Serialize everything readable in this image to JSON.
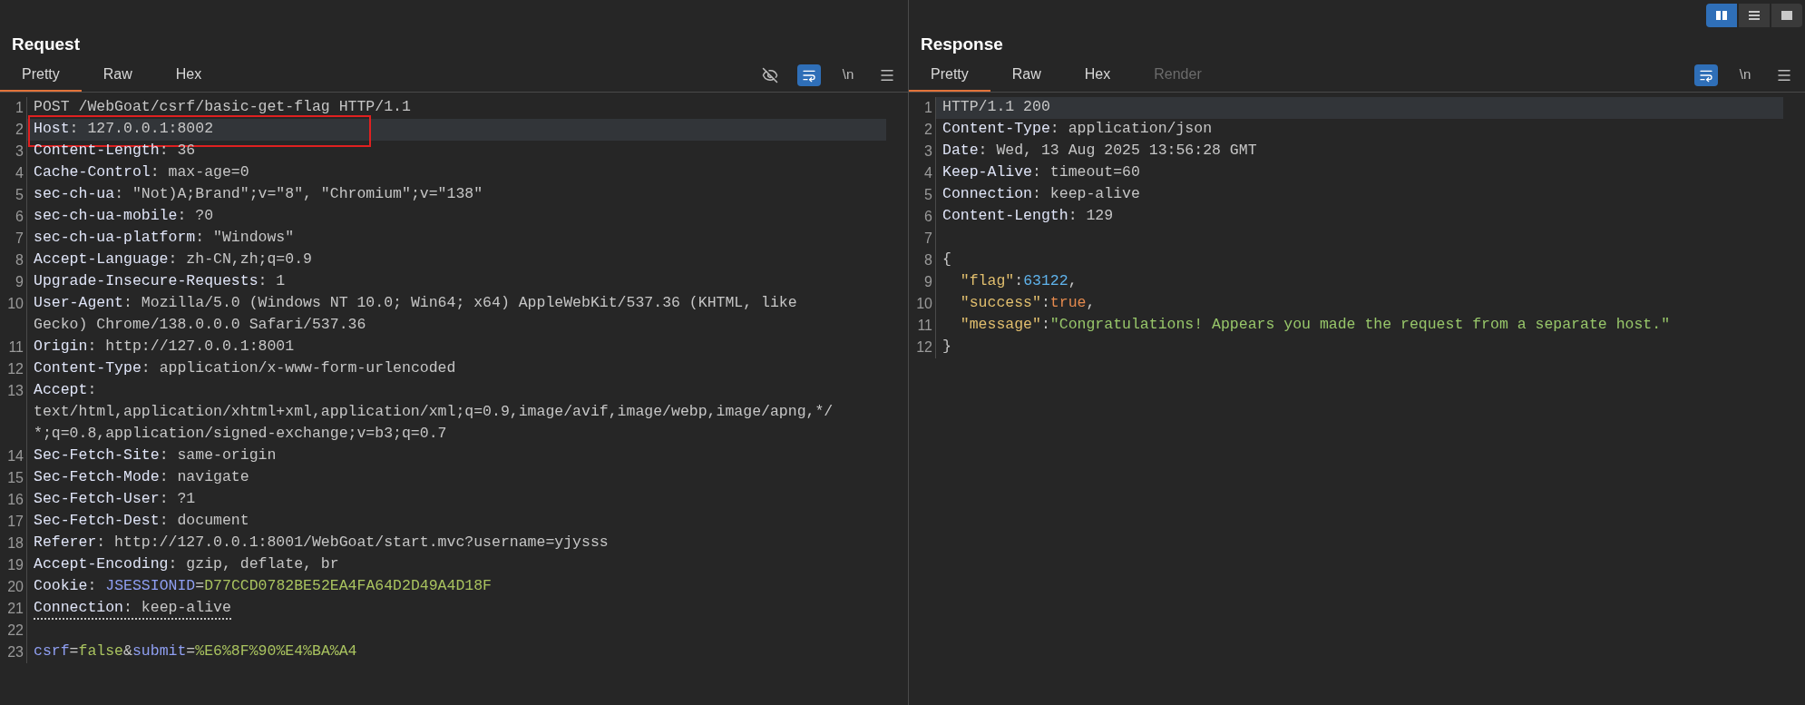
{
  "layout_toggles": [
    {
      "kind": "columns",
      "selected": true
    },
    {
      "kind": "rows",
      "selected": false
    },
    {
      "kind": "single",
      "selected": false
    }
  ],
  "panes": [
    {
      "title": "Request",
      "tabs": [
        {
          "label": "Pretty",
          "selected": true,
          "disabled": false
        },
        {
          "label": "Raw",
          "selected": false,
          "disabled": false
        },
        {
          "label": "Hex",
          "selected": false,
          "disabled": false
        }
      ],
      "toolbar": [
        {
          "kind": "eye-off",
          "on": false
        },
        {
          "kind": "wrap",
          "on": true
        },
        {
          "kind": "newline",
          "label": "\\n",
          "on": false
        },
        {
          "kind": "menu",
          "on": false
        }
      ],
      "lines": [
        {
          "number": "1",
          "selected": false,
          "boxed": false,
          "warning": false,
          "rows": [
            [
              {
                "kind": "text",
                "text": "POST /WebGoat/csrf/basic-get-flag HTTP/1.1"
              }
            ]
          ]
        },
        {
          "number": "2",
          "selected": true,
          "boxed": true,
          "warning": false,
          "rows": [
            [
              {
                "kind": "name",
                "text": "Host"
              },
              {
                "kind": "text",
                "text": ": 127.0.0.1:8002"
              }
            ]
          ]
        },
        {
          "number": "3",
          "selected": false,
          "boxed": false,
          "warning": false,
          "rows": [
            [
              {
                "kind": "name",
                "text": "Content-Length"
              },
              {
                "kind": "text",
                "text": ": 36"
              }
            ]
          ]
        },
        {
          "number": "4",
          "selected": false,
          "boxed": false,
          "warning": false,
          "rows": [
            [
              {
                "kind": "name",
                "text": "Cache-Control"
              },
              {
                "kind": "text",
                "text": ": max-age=0"
              }
            ]
          ]
        },
        {
          "number": "5",
          "selected": false,
          "boxed": false,
          "warning": false,
          "rows": [
            [
              {
                "kind": "name",
                "text": "sec-ch-ua"
              },
              {
                "kind": "text",
                "text": ": \"Not)A;Brand\";v=\"8\", \"Chromium\";v=\"138\""
              }
            ]
          ]
        },
        {
          "number": "6",
          "selected": false,
          "boxed": false,
          "warning": false,
          "rows": [
            [
              {
                "kind": "name",
                "text": "sec-ch-ua-mobile"
              },
              {
                "kind": "text",
                "text": ": ?0"
              }
            ]
          ]
        },
        {
          "number": "7",
          "selected": false,
          "boxed": false,
          "warning": false,
          "rows": [
            [
              {
                "kind": "name",
                "text": "sec-ch-ua-platform"
              },
              {
                "kind": "text",
                "text": ": \"Windows\""
              }
            ]
          ]
        },
        {
          "number": "8",
          "selected": false,
          "boxed": false,
          "warning": false,
          "rows": [
            [
              {
                "kind": "name",
                "text": "Accept-Language"
              },
              {
                "kind": "text",
                "text": ": zh-CN,zh;q=0.9"
              }
            ]
          ]
        },
        {
          "number": "9",
          "selected": false,
          "boxed": false,
          "warning": false,
          "rows": [
            [
              {
                "kind": "name",
                "text": "Upgrade-Insecure-Requests"
              },
              {
                "kind": "text",
                "text": ": 1"
              }
            ]
          ]
        },
        {
          "number": "10",
          "selected": false,
          "boxed": false,
          "warning": false,
          "rows": [
            [
              {
                "kind": "name",
                "text": "User-Agent"
              },
              {
                "kind": "text",
                "text": ": Mozilla/5.0 (Windows NT 10.0; Win64; x64) AppleWebKit/537.36 (KHTML, like"
              }
            ],
            [
              {
                "kind": "text",
                "text": "Gecko) Chrome/138.0.0.0 Safari/537.36"
              }
            ]
          ]
        },
        {
          "number": "11",
          "selected": false,
          "boxed": false,
          "warning": false,
          "rows": [
            [
              {
                "kind": "name",
                "text": "Origin"
              },
              {
                "kind": "text",
                "text": ": http://127.0.0.1:8001"
              }
            ]
          ]
        },
        {
          "number": "12",
          "selected": false,
          "boxed": false,
          "warning": false,
          "rows": [
            [
              {
                "kind": "name",
                "text": "Content-Type"
              },
              {
                "kind": "text",
                "text": ": application/x-www-form-urlencoded"
              }
            ]
          ]
        },
        {
          "number": "13",
          "selected": false,
          "boxed": false,
          "warning": false,
          "rows": [
            [
              {
                "kind": "name",
                "text": "Accept"
              },
              {
                "kind": "text",
                "text": ":"
              }
            ],
            [
              {
                "kind": "text",
                "text": "text/html,application/xhtml+xml,application/xml;q=0.9,image/avif,image/webp,image/apng,*/"
              }
            ],
            [
              {
                "kind": "text",
                "text": "*;q=0.8,application/signed-exchange;v=b3;q=0.7"
              }
            ]
          ]
        },
        {
          "number": "14",
          "selected": false,
          "boxed": false,
          "warning": false,
          "rows": [
            [
              {
                "kind": "name",
                "text": "Sec-Fetch-Site"
              },
              {
                "kind": "text",
                "text": ": same-origin"
              }
            ]
          ]
        },
        {
          "number": "15",
          "selected": false,
          "boxed": false,
          "warning": false,
          "rows": [
            [
              {
                "kind": "name",
                "text": "Sec-Fetch-Mode"
              },
              {
                "kind": "text",
                "text": ": navigate"
              }
            ]
          ]
        },
        {
          "number": "16",
          "selected": false,
          "boxed": false,
          "warning": false,
          "rows": [
            [
              {
                "kind": "name",
                "text": "Sec-Fetch-User"
              },
              {
                "kind": "text",
                "text": ": ?1"
              }
            ]
          ]
        },
        {
          "number": "17",
          "selected": false,
          "boxed": false,
          "warning": false,
          "rows": [
            [
              {
                "kind": "name",
                "text": "Sec-Fetch-Dest"
              },
              {
                "kind": "text",
                "text": ": document"
              }
            ]
          ]
        },
        {
          "number": "18",
          "selected": false,
          "boxed": false,
          "warning": false,
          "rows": [
            [
              {
                "kind": "name",
                "text": "Referer"
              },
              {
                "kind": "text",
                "text": ": http://127.0.0.1:8001/WebGoat/start.mvc?username=yjysss"
              }
            ]
          ]
        },
        {
          "number": "19",
          "selected": false,
          "boxed": false,
          "warning": false,
          "rows": [
            [
              {
                "kind": "name",
                "text": "Accept-Encoding"
              },
              {
                "kind": "text",
                "text": ": gzip, deflate, br"
              }
            ]
          ]
        },
        {
          "number": "20",
          "selected": false,
          "boxed": false,
          "warning": false,
          "rows": [
            [
              {
                "kind": "name",
                "text": "Cookie"
              },
              {
                "kind": "text",
                "text": ": "
              },
              {
                "kind": "param",
                "text": "JSESSIONID"
              },
              {
                "kind": "text",
                "text": "="
              },
              {
                "kind": "pvalue",
                "text": "D77CCD0782BE52EA4FA64D2D49A4D18F"
              }
            ]
          ]
        },
        {
          "number": "21",
          "selected": false,
          "boxed": false,
          "warning": true,
          "rows": [
            [
              {
                "kind": "name",
                "text": "Connection"
              },
              {
                "kind": "text",
                "text": ": keep-alive"
              }
            ]
          ]
        },
        {
          "number": "22",
          "selected": false,
          "boxed": false
        },
        {
          "number": "23",
          "selected": false,
          "boxed": false,
          "warning": false,
          "rows": [
            [
              {
                "kind": "param",
                "text": "csrf"
              },
              {
                "kind": "text",
                "text": "="
              },
              {
                "kind": "pvalue",
                "text": "false"
              },
              {
                "kind": "text",
                "text": "&"
              },
              {
                "kind": "param",
                "text": "submit"
              },
              {
                "kind": "text",
                "text": "="
              },
              {
                "kind": "pvalue",
                "text": "%E6%8F%90%E4%BA%A4"
              }
            ]
          ]
        }
      ]
    },
    {
      "title": "Response",
      "tabs": [
        {
          "label": "Pretty",
          "selected": true,
          "disabled": false
        },
        {
          "label": "Raw",
          "selected": false,
          "disabled": false
        },
        {
          "label": "Hex",
          "selected": false,
          "disabled": false
        },
        {
          "label": "Render",
          "selected": false,
          "disabled": true
        }
      ],
      "toolbar": [
        {
          "kind": "wrap",
          "on": true
        },
        {
          "kind": "newline",
          "label": "\\n",
          "on": false
        },
        {
          "kind": "menu",
          "on": false
        }
      ],
      "lines": [
        {
          "number": "1",
          "selected": true,
          "boxed": false,
          "warning": false,
          "rows": [
            [
              {
                "kind": "text",
                "text": "HTTP/1.1 200"
              }
            ]
          ]
        },
        {
          "number": "2",
          "selected": false,
          "boxed": false,
          "warning": false,
          "rows": [
            [
              {
                "kind": "name",
                "text": "Content-Type"
              },
              {
                "kind": "text",
                "text": ": application/json"
              }
            ]
          ]
        },
        {
          "number": "3",
          "selected": false,
          "boxed": false,
          "warning": false,
          "rows": [
            [
              {
                "kind": "name",
                "text": "Date"
              },
              {
                "kind": "text",
                "text": ": Wed, 13 Aug 2025 13:56:28 GMT"
              }
            ]
          ]
        },
        {
          "number": "4",
          "selected": false,
          "boxed": false,
          "warning": false,
          "rows": [
            [
              {
                "kind": "name",
                "text": "Keep-Alive"
              },
              {
                "kind": "text",
                "text": ": timeout=60"
              }
            ]
          ]
        },
        {
          "number": "5",
          "selected": false,
          "boxed": false,
          "warning": false,
          "rows": [
            [
              {
                "kind": "name",
                "text": "Connection"
              },
              {
                "kind": "text",
                "text": ": keep-alive"
              }
            ]
          ]
        },
        {
          "number": "6",
          "selected": false,
          "boxed": false,
          "warning": false,
          "rows": [
            [
              {
                "kind": "name",
                "text": "Content-Length"
              },
              {
                "kind": "text",
                "text": ": 129"
              }
            ]
          ]
        },
        {
          "number": "7",
          "selected": false,
          "boxed": false
        },
        {
          "number": "8",
          "selected": false,
          "boxed": false,
          "warning": false,
          "rows": [
            [
              {
                "kind": "text",
                "text": "{"
              }
            ]
          ]
        },
        {
          "number": "9",
          "selected": false,
          "boxed": false,
          "warning": false,
          "rows": [
            [
              {
                "kind": "jkey",
                "text": "  \"flag\""
              },
              {
                "kind": "text",
                "text": ":"
              },
              {
                "kind": "jnum",
                "text": "63122"
              },
              {
                "kind": "text",
                "text": ","
              }
            ]
          ]
        },
        {
          "number": "10",
          "selected": false,
          "boxed": false,
          "warning": false,
          "rows": [
            [
              {
                "kind": "jkey",
                "text": "  \"success\""
              },
              {
                "kind": "text",
                "text": ":"
              },
              {
                "kind": "jbool",
                "text": "true"
              },
              {
                "kind": "text",
                "text": ","
              }
            ]
          ]
        },
        {
          "number": "11",
          "selected": false,
          "boxed": false,
          "warning": false,
          "rows": [
            [
              {
                "kind": "jkey",
                "text": "  \"message\""
              },
              {
                "kind": "text",
                "text": ":"
              },
              {
                "kind": "jstr",
                "text": "\"Congratulations! Appears you made the request from a separate host.\""
              }
            ]
          ]
        },
        {
          "number": "12",
          "selected": false,
          "boxed": false,
          "warning": false,
          "rows": [
            [
              {
                "kind": "text",
                "text": "}"
              }
            ]
          ]
        }
      ]
    }
  ]
}
